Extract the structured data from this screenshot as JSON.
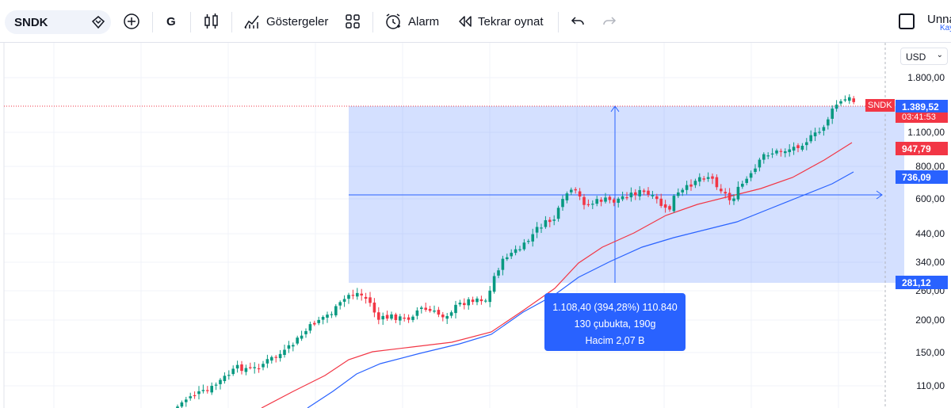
{
  "toolbar": {
    "symbol": "SNDK",
    "interval": "G",
    "indicators_label": "Göstergeler",
    "alert_label": "Alarm",
    "replay_label": "Tekrar oynat",
    "right_title": "Unna",
    "right_subtitle": "Kay"
  },
  "chart": {
    "currency": "USD",
    "price_axis": [
      "1.800,00",
      "1.100,00",
      "800,00",
      "600,00",
      "440,00",
      "340,00",
      "260,00",
      "200,00",
      "150,00",
      "110,00"
    ],
    "symbol_tag": "SNDK",
    "last_price": "1.389,52",
    "countdown": "03:41:53",
    "ma_fast_value": "947,79",
    "ma_slow_value": "736,09",
    "range_low_value": "281,12",
    "measure": {
      "line1": "1.108,40 (394,28%) 110.840",
      "line2": "130 çubukta, 190g",
      "line3": "Hacim 2,07 B"
    },
    "colors": {
      "up": "#089981",
      "down": "#f23645",
      "ma_fast": "#f23645",
      "ma_slow": "#2962ff",
      "measure_fill": "#2962ff",
      "measure_label_bg": "#2962ff",
      "slow_badge": "#2962ff",
      "fast_badge": "#f23645",
      "price_badge": "#2962ff"
    }
  }
}
